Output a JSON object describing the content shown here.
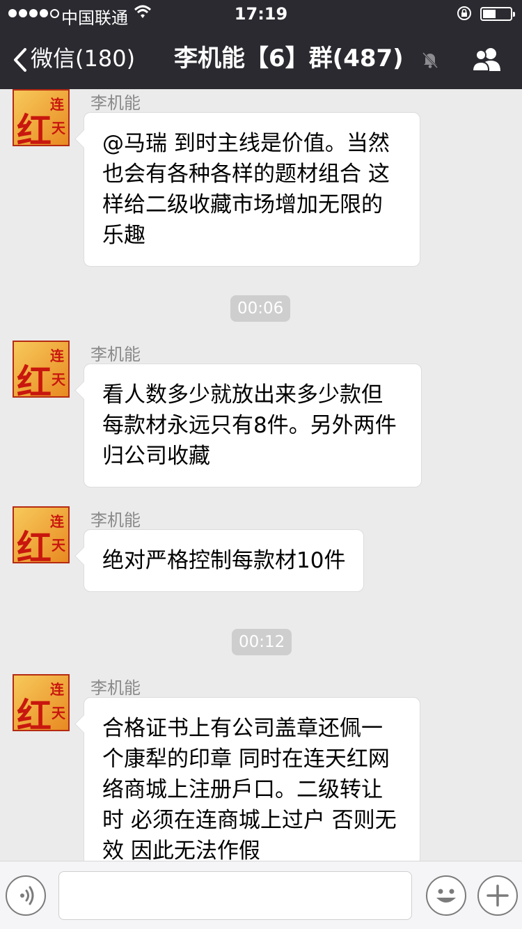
{
  "status_bar": {
    "carrier": "中国联通",
    "time": "17:19"
  },
  "nav": {
    "back_label": "微信(180)",
    "title": "李机能【6】群(487)"
  },
  "messages": [
    {
      "sender": "李机能",
      "text": "@马瑞 到时主线是价值。当然也会有各种各样的题材组合  这样给二级收藏市场增加无限的乐趣"
    },
    {
      "sender": "李机能",
      "text": "看人数多少就放出来多少款但每款材永远只有8件。另外两件归公司收藏"
    },
    {
      "sender": "李机能",
      "text": "绝对严格控制每款材10件"
    },
    {
      "sender": "李机能",
      "text": "合格证书上有公司盖章还佩一个康犁的印章 同时在连天红网络商城上注册戶口。二级转让时 必须在连商城上过户 否则无效  因此无法作假"
    }
  ],
  "timestamps": [
    "00:06",
    "00:12"
  ],
  "avatar": {
    "chars": [
      "红",
      "连",
      "天"
    ]
  },
  "input_bar": {
    "placeholder": ""
  },
  "icons": {
    "back": "chevron-left-icon",
    "mute": "bell-muted-icon",
    "members": "people-icon",
    "voice": "voice-icon",
    "emoji": "smiley-icon",
    "more": "plus-icon"
  },
  "colors": {
    "nav_bg": "#2b2a30",
    "chat_bg": "#ebebeb",
    "avatar_red": "#c8170e"
  }
}
